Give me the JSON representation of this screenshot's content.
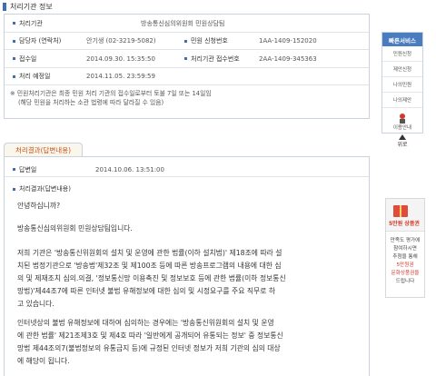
{
  "agency_section": {
    "title": "처리기관 정보",
    "rows": {
      "agency": {
        "label": "처리기관",
        "value": "방송통신심의위원회 민원상담팀"
      },
      "staff": {
        "label": "담당자 (연락처)",
        "value": "안기생 (02-3219-5082)",
        "label2": "민원 신청번호",
        "value2": "1AA-1409-152020"
      },
      "received": {
        "label": "접수일",
        "value": "2014.09.30. 15:35:50",
        "label2": "처리기관 접수번호",
        "value2": "2AA-1409-345363"
      },
      "due": {
        "label": "처리 예정일",
        "value": "2014.11.05. 23:59:59"
      }
    },
    "note_line1": "※ 민원처리기관은 최종 민원 처리 기관의 접수일로부터 토불 7일 또는 14일임",
    "note_line2": "(해당 민원을 처리하는 소관 법령에 따라 달라질 수 있음)"
  },
  "result_section": {
    "tab_label": "처리결과(답변내용)",
    "answer_date_label": "답변일",
    "answer_date_value": "2014.10.06. 13:51:00",
    "result_label": "처리결과(답변내용)",
    "lines": [
      "안녕하십니까?",
      "방송통신심의위원회 민원상담팀입니다.",
      "저희 기관은 '방송통신위원회의 설치 및 운영에 관한 법률(이하 설치법)' 제18조에 따라 설",
      "치된 법정기관으로 '방송법'제32조 및 제100조 등에 따른 방송프로그램의 내용에 대한 심",
      "의 및 제재조치 심의.의결, '정보통신망 이용촉진 및 정보보호 등에 관한 법률(이하 정보통신",
      "망법)'제44조7에 따른 인터넷 불법 유해정보에 대한 심의 및 시정요구를 주요 직무로 하",
      "고 있습니다.",
      "인터넷상의 불법 유해정보에 대하여 심의하는 경우에는 '방송통신위원회의 설치 및 운영",
      "에 관한 법률' 제21조제3호 및 제4호 따라 '일반에게 공개되어 유통되는 정보' 중 정보통신",
      "망법 제44조의7(불법정보의 유통금지 등)에 규정된 인터넷 정보가 저희 기관의 심의 대상",
      "에 해당이 됩니다."
    ]
  },
  "quick_service": {
    "title": "빠른서비스",
    "items": [
      "민원신청",
      "제안신청",
      "나의민원",
      "나의제안"
    ],
    "guide_label": "이용안내",
    "top_label": "위로"
  },
  "survey_banner": {
    "gift_label": "5만원 상품권",
    "line1": "만족도 평가에",
    "line2": "참여하시면",
    "line3": "추첨을 통해",
    "line4": "5만원권",
    "line5": "문화상품권을",
    "line6": "드립니다"
  },
  "colors": {
    "accent": "#3f6fb0",
    "tab_text": "#c0561d",
    "promo_red": "#d23a2a"
  }
}
